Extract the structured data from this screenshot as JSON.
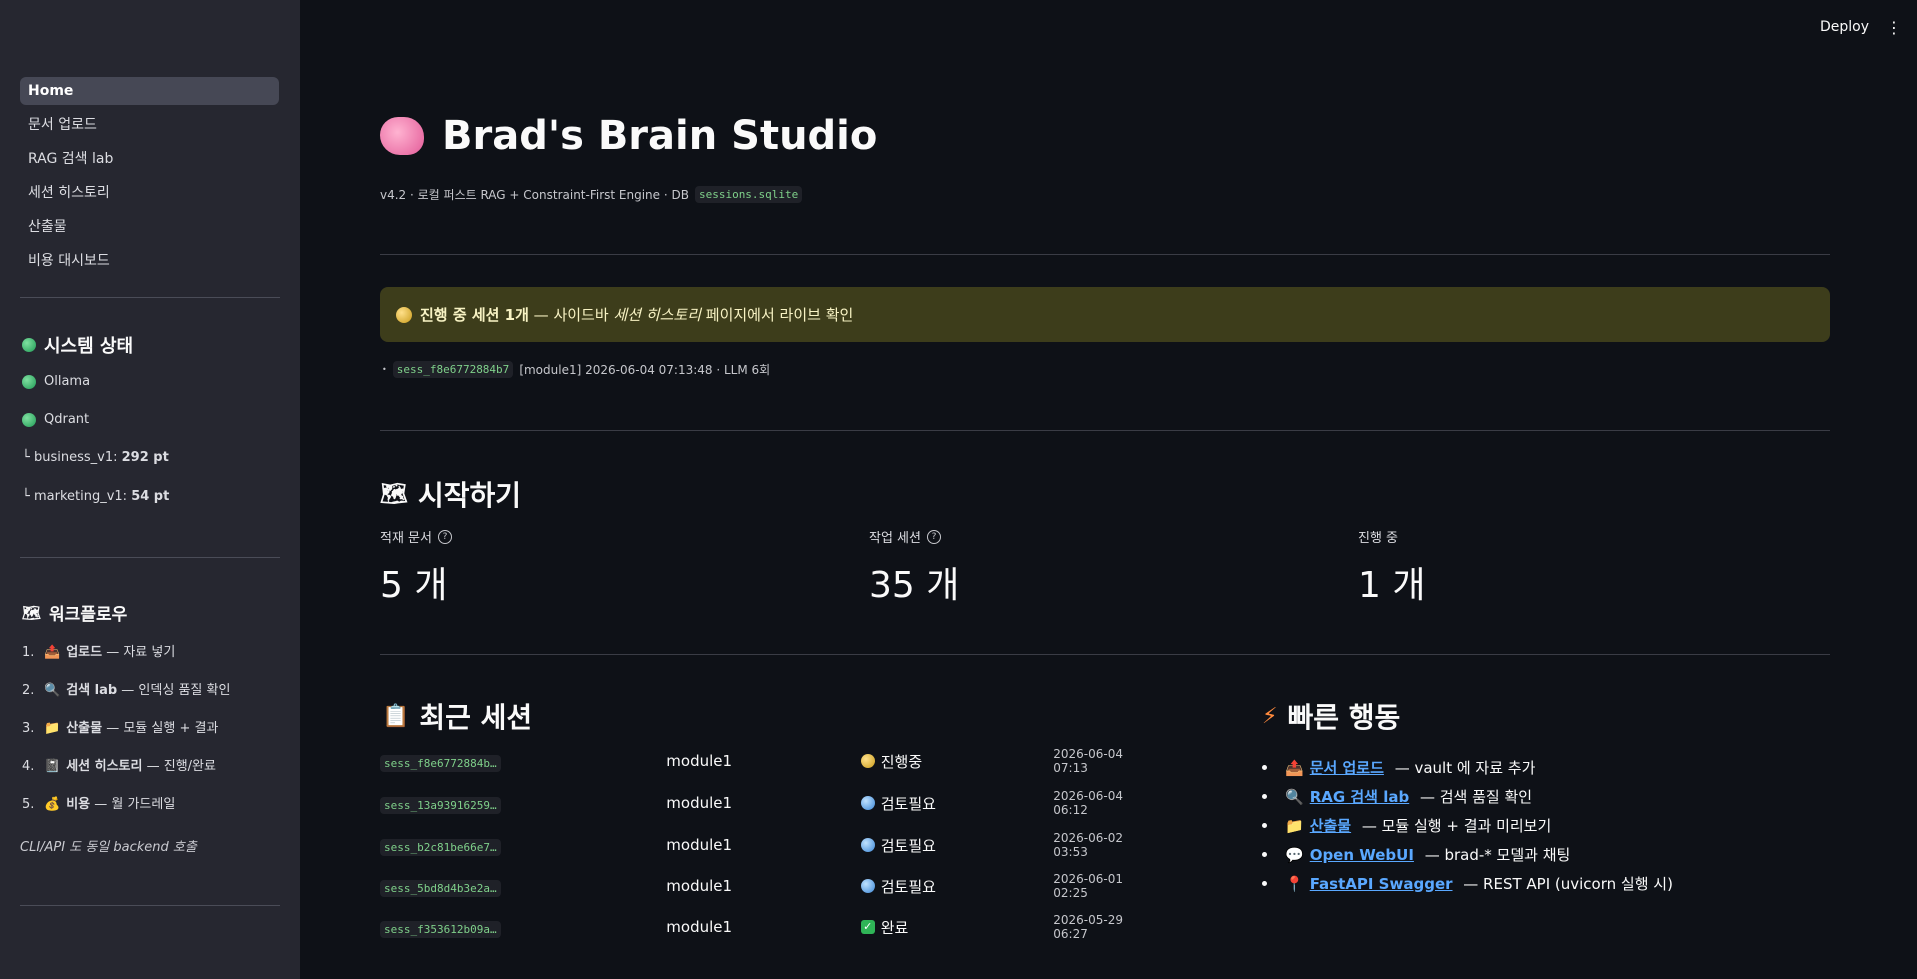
{
  "header": {
    "deploy_label": "Deploy",
    "menu_label": "⋮"
  },
  "sidebar": {
    "nav": [
      {
        "label": "Home",
        "active": true
      },
      {
        "label": "문서 업로드"
      },
      {
        "label": "RAG 검색 lab"
      },
      {
        "label": "세션 히스토리"
      },
      {
        "label": "산출물"
      },
      {
        "label": "비용 대시보드"
      }
    ],
    "system_status": {
      "title": "시스템 상태",
      "services": [
        {
          "label": "Ollama",
          "status": "green"
        },
        {
          "label": "Qdrant",
          "status": "green"
        }
      ],
      "collections": [
        {
          "prefix": "└ ",
          "name": "business_v1: ",
          "count": "292 pt"
        },
        {
          "prefix": "└ ",
          "name": "marketing_v1: ",
          "count": "54 pt"
        }
      ]
    },
    "workflow": {
      "title": "워크플로우",
      "items": [
        {
          "num": "1.",
          "icon": "📤",
          "name": "업로드",
          "desc": " — 자료 넣기"
        },
        {
          "num": "2.",
          "icon": "🔍",
          "name": "검색 lab",
          "desc": " — 인덱싱 품질 확인"
        },
        {
          "num": "3.",
          "icon": "📁",
          "name": "산출물",
          "desc": " — 모듈 실행 + 결과"
        },
        {
          "num": "4.",
          "icon": "📓",
          "name": "세션 히스토리",
          "desc": " — 진행/완료"
        },
        {
          "num": "5.",
          "icon": "💰",
          "name": "비용",
          "desc": " — 월 가드레일"
        }
      ],
      "footer": "CLI/API 도 동일 backend 호출"
    }
  },
  "main": {
    "title": "Brad's Brain Studio",
    "subtitle": "v4.2 · 로컬 퍼스트 RAG + Constraint-First Engine · DB",
    "db_name": "sessions.sqlite",
    "alert": {
      "strong": "진행 중 세션 1개",
      "text_before": " — 사이드바 ",
      "em": "세션 히스토리",
      "text_after": " 페이지에서 라이브 확인"
    },
    "active_session": {
      "id": "sess_f8e6772884b7",
      "detail": "[module1] 2026-06-04 07:13:48 · LLM 6회"
    },
    "getting_started": {
      "title": "시작하기",
      "metrics": [
        {
          "label": "적재 문서",
          "value": "5 개",
          "help": true
        },
        {
          "label": "작업 세션",
          "value": "35 개",
          "help": true
        },
        {
          "label": "진행 중",
          "value": "1 개",
          "help": false
        }
      ]
    },
    "recent_sessions": {
      "title": "최근 세션",
      "rows": [
        {
          "id": "sess_f8e6772884b…",
          "module": "module1",
          "status": "진행중",
          "status_type": "progress",
          "time": "2026-06-04 07:13"
        },
        {
          "id": "sess_13a93916259…",
          "module": "module1",
          "status": "검토필요",
          "status_type": "review",
          "time": "2026-06-04 06:12"
        },
        {
          "id": "sess_b2c81be66e7…",
          "module": "module1",
          "status": "검토필요",
          "status_type": "review",
          "time": "2026-06-02 03:53"
        },
        {
          "id": "sess_5bd8d4b3e2a…",
          "module": "module1",
          "status": "검토필요",
          "status_type": "review",
          "time": "2026-06-01 02:25"
        },
        {
          "id": "sess_f353612b09a…",
          "module": "module1",
          "status": "완료",
          "status_type": "done",
          "time": "2026-05-29 06:27"
        }
      ]
    },
    "quick_actions": {
      "title": "빠른 행동",
      "items": [
        {
          "icon": "📤",
          "link": "문서 업로드",
          "desc": " — vault 에 자료 추가"
        },
        {
          "icon": "🔍",
          "link": "RAG 검색 lab",
          "desc": " — 검색 품질 확인"
        },
        {
          "icon": "📁",
          "link": "산출물",
          "desc": " — 모듈 실행 + 결과 미리보기"
        },
        {
          "icon": "💬",
          "link": "Open WebUI",
          "desc": " — brad-* 모델과 채팅"
        },
        {
          "icon": "📍",
          "link": "FastAPI Swagger",
          "desc": " — REST API (uvicorn 실행 시)"
        }
      ]
    }
  }
}
